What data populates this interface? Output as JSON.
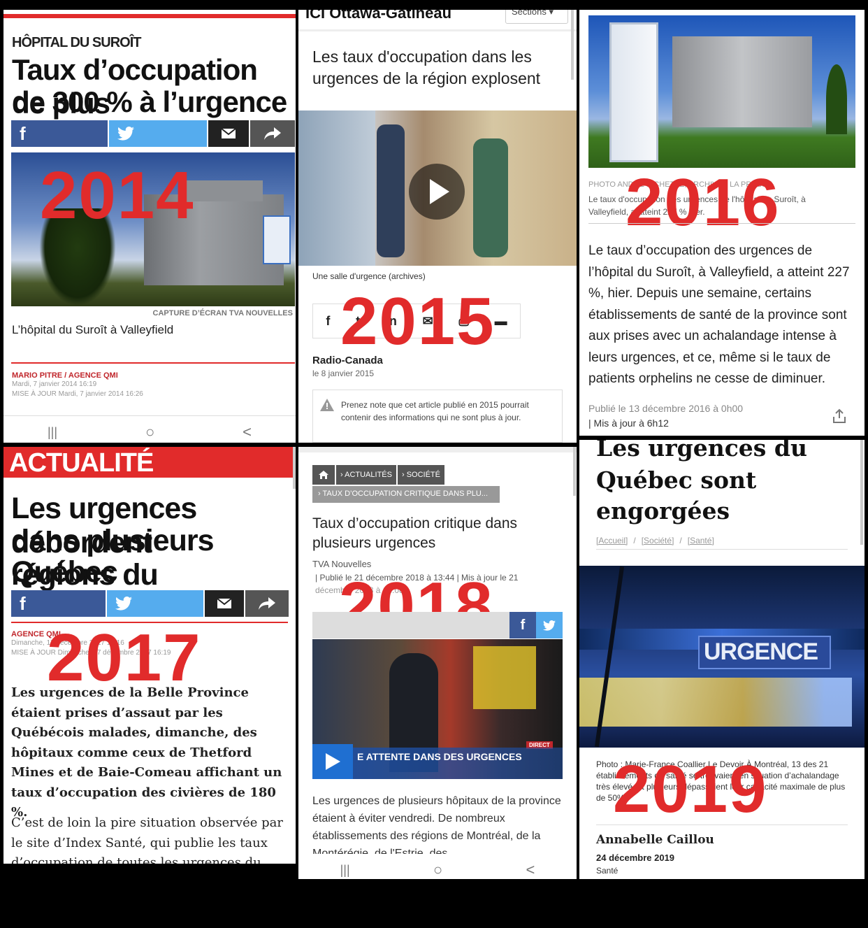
{
  "panel_2014": {
    "kicker": "HÔPITAL DU SUROÎT",
    "title_line1": "Taux d’occupation de plus",
    "title_line2": "de 300 % à l’urgence",
    "year": "2014",
    "photo_credit": "CAPTURE D’ÉCRAN TVA NOUVELLES",
    "caption": "L’hôpital du Suroît à Valleyfield",
    "author": "MARIO PITRE / AGENCE QMI",
    "date": "Mardi, 7 janvier 2014 16:19",
    "updated": "MISE À JOUR Mardi, 7 janvier 2014 16:26"
  },
  "panel_2015": {
    "header_site": "ICI Ottawa-Gatineau",
    "header_sections": "Sections",
    "title": "Les taux d'occupation dans les urgences de la région explosent",
    "video_caption": "Une salle d'urgence (archives)",
    "year": "2015",
    "source": "Radio-Canada",
    "date": "le 8 janvier 2015",
    "notice": "Prenez note que cet article publié en 2015 pourrait contenir des informations qui ne sont plus à jour."
  },
  "panel_2016": {
    "photo_credit": "PHOTO ANDRÉ PICHETTE, ARCHIVES LA PRESSE",
    "caption": "Le taux d'occupation des urgences de l'hôpital du Suroît, à Valleyfield, a atteint 227 % hier.",
    "year": "2016",
    "body": "Le taux d’occupation des urgences de l’hôpital du Suroît, à Valleyfield, a atteint 227 %, hier. Depuis une semaine, certains établissements de santé de la province sont aux prises avec un achalandage intense à leurs urgences, et ce, même si le taux de patients orphelins ne cesse de diminuer.",
    "published": "Publié le 13 décembre 2016 à 0h00",
    "updated": "| Mis à jour à 6h12"
  },
  "panel_2017": {
    "section": "ACTUALITÉ",
    "title_line1": "Les urgences débordent",
    "title_line2": "dans plusieurs régions du",
    "title_line3": "Québec",
    "author": "AGENCE QMI",
    "date": "Dimanche, 17 décembre 2017 16:16",
    "updated": "MISE À JOUR Dimanche, 17 décembre 2017 16:19",
    "year": "2017",
    "lead": "Les urgences de la Belle Province étaient prises d’assaut par les Québécois malades, dimanche, des hôpitaux comme ceux de Thetford Mines et de Baie-Comeau affichant un taux d’occupation des civières de 180 %.",
    "body": "C’est de loin la pire situation observée par le site d’Index Santé, qui publie les taux d’occupation de toutes les urgences du"
  },
  "panel_2018": {
    "crumb1": "› ACTUALITÉS",
    "crumb2": "› SOCIÉTÉ",
    "crumb3": "› TAUX D’OCCUPATION CRITIQUE DANS PLU...",
    "title": "Taux d’occupation critique dans plusieurs urgences",
    "source": "TVA Nouvelles",
    "published": "| Publié le 21 décembre 2018 à 13:44 | Mis à jour le 21",
    "published2": "décembre 2018 à 18:08",
    "year": "2018",
    "video_banner": "E ATTENTE DANS DES URGENCES",
    "direct": "DIRECT",
    "body": "Les urgences de plusieurs hôpitaux de la province étaient à éviter vendredi. De nombreux établissements des régions de Montréal, de la Montérégie, de l'Estrie, des"
  },
  "panel_2019": {
    "title_line1": "Les urgences du",
    "title_line2": "Québec sont",
    "title_line3": "engorgées",
    "crumbs": [
      "[Accueil]",
      "[Société]",
      "[Santé]"
    ],
    "sign": "URGENCE",
    "caption": "Photo : Marie-France Coallier Le Devoir À Montréal, 13 des 21 établissements de santé se trouvaient en situation d’achalandage très élevé, et plusieurs dépassaient leur capacité maximale de plus de 50%.",
    "year": "2019",
    "author": "Annabelle Caillou",
    "date": "24 décembre 2019",
    "category": "Santé"
  },
  "nav": {
    "recent": "|||",
    "home": "○",
    "back": "<"
  }
}
